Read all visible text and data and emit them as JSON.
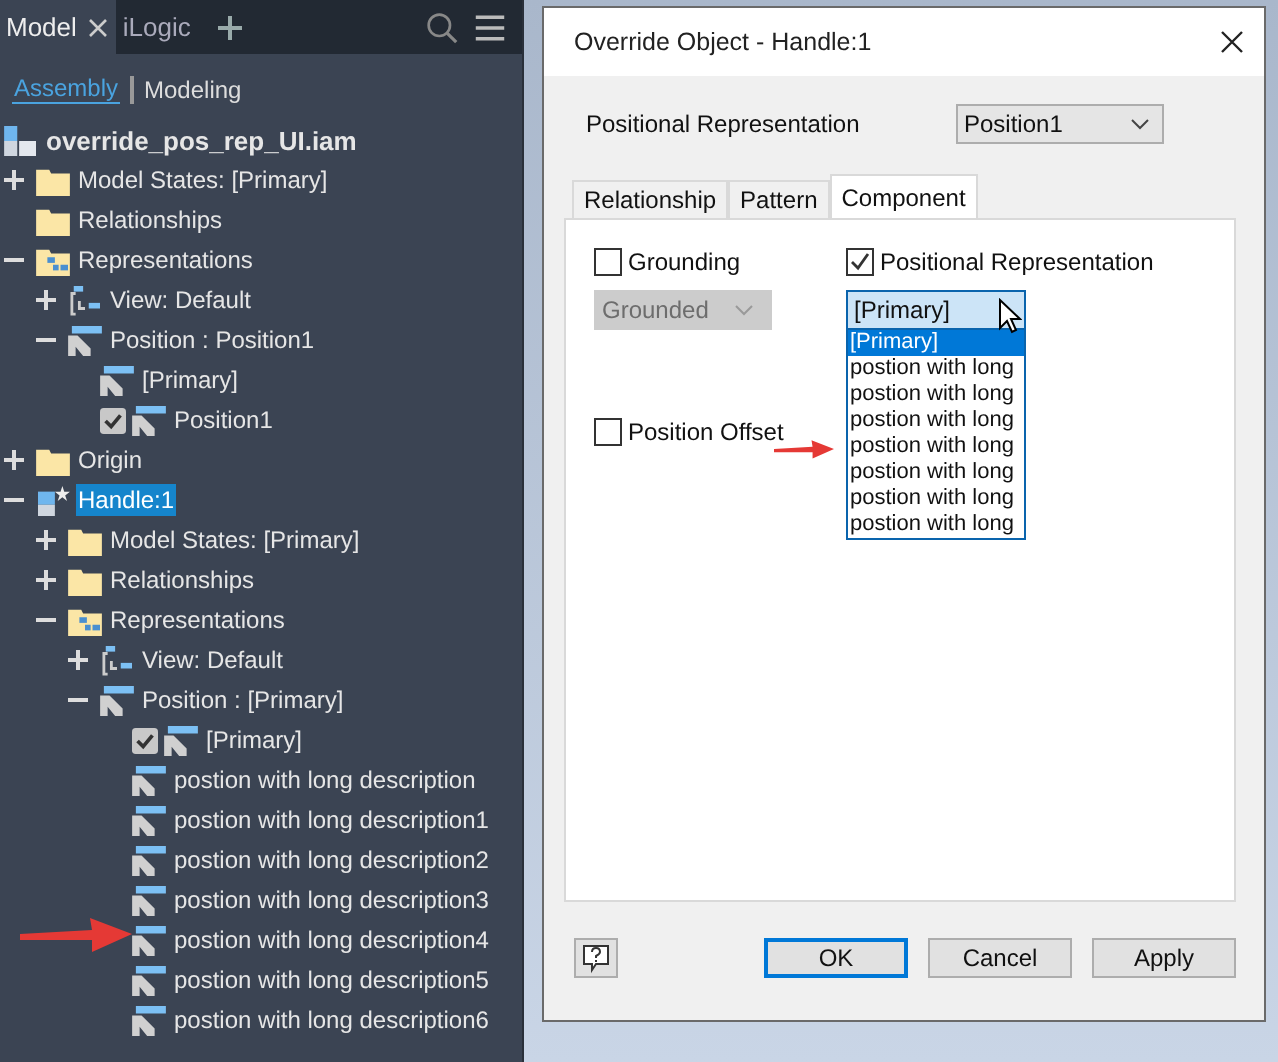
{
  "browser": {
    "tabs": [
      {
        "label": "Model",
        "selected": true
      },
      {
        "label": "iLogic",
        "selected": false
      }
    ],
    "modes": [
      {
        "label": "Assembly",
        "selected": true
      },
      {
        "label": "Modeling",
        "selected": false
      }
    ],
    "tree": [
      {
        "label": "override_pos_rep_UI.iam",
        "kind": "assembly",
        "children": [
          {
            "label": "Model States: [Primary]",
            "kind": "folder",
            "expanded": false
          },
          {
            "label": "Relationships",
            "kind": "folder"
          },
          {
            "label": "Representations",
            "kind": "repfolder",
            "expanded": true,
            "children": [
              {
                "label": "View: Default",
                "kind": "view",
                "expanded": false
              },
              {
                "label": "Position : Position1",
                "kind": "position",
                "expanded": true,
                "children": [
                  {
                    "label": "[Primary]",
                    "kind": "position"
                  },
                  {
                    "label": "Position1",
                    "kind": "position",
                    "checked": true
                  }
                ]
              }
            ]
          },
          {
            "label": "Origin",
            "kind": "folder",
            "expanded": false
          },
          {
            "label": "Handle:1",
            "kind": "part",
            "expanded": true,
            "selected": true,
            "children": [
              {
                "label": "Model States: [Primary]",
                "kind": "folder",
                "expanded": false
              },
              {
                "label": "Relationships",
                "kind": "folder",
                "expanded": false
              },
              {
                "label": "Representations",
                "kind": "repfolder",
                "expanded": true,
                "children": [
                  {
                    "label": "View: Default",
                    "kind": "view",
                    "expanded": false
                  },
                  {
                    "label": "Position : [Primary]",
                    "kind": "position",
                    "expanded": true,
                    "children": [
                      {
                        "label": "[Primary]",
                        "kind": "position",
                        "checked": true
                      },
                      {
                        "label": "postion with long description",
                        "kind": "position"
                      },
                      {
                        "label": "postion with long description1",
                        "kind": "position"
                      },
                      {
                        "label": "postion with long description2",
                        "kind": "position"
                      },
                      {
                        "label": "postion with long description3",
                        "kind": "position"
                      },
                      {
                        "label": "postion with long description4",
                        "kind": "position"
                      },
                      {
                        "label": "postion with long description5",
                        "kind": "position"
                      },
                      {
                        "label": "postion with long description6",
                        "kind": "position"
                      }
                    ]
                  }
                ]
              }
            ]
          }
        ]
      }
    ]
  },
  "dialog": {
    "title": "Override Object - Handle:1",
    "positional_representation": {
      "label": "Positional Representation",
      "value": "Position1"
    },
    "tabs": [
      {
        "label": "Relationship",
        "selected": false
      },
      {
        "label": "Pattern",
        "selected": false
      },
      {
        "label": "Component",
        "selected": true
      }
    ],
    "grounding": {
      "label": "Grounding",
      "checked": false,
      "value": "Grounded",
      "disabled": true
    },
    "position_rep": {
      "label": "Positional Representation",
      "checked": true,
      "value": "[Primary]",
      "options": [
        {
          "label": "[Primary]",
          "selected": true
        },
        {
          "label": "postion with long",
          "selected": false
        },
        {
          "label": "postion with long",
          "selected": false
        },
        {
          "label": "postion with long",
          "selected": false
        },
        {
          "label": "postion with long",
          "selected": false
        },
        {
          "label": "postion with long",
          "selected": false
        },
        {
          "label": "postion with long",
          "selected": false
        },
        {
          "label": "postion with long",
          "selected": false
        }
      ]
    },
    "position_offset": {
      "label": "Position Offset",
      "checked": false
    },
    "buttons": [
      {
        "label": "OK",
        "default": true
      },
      {
        "label": "Cancel",
        "default": false
      },
      {
        "label": "Apply",
        "default": false
      }
    ]
  }
}
